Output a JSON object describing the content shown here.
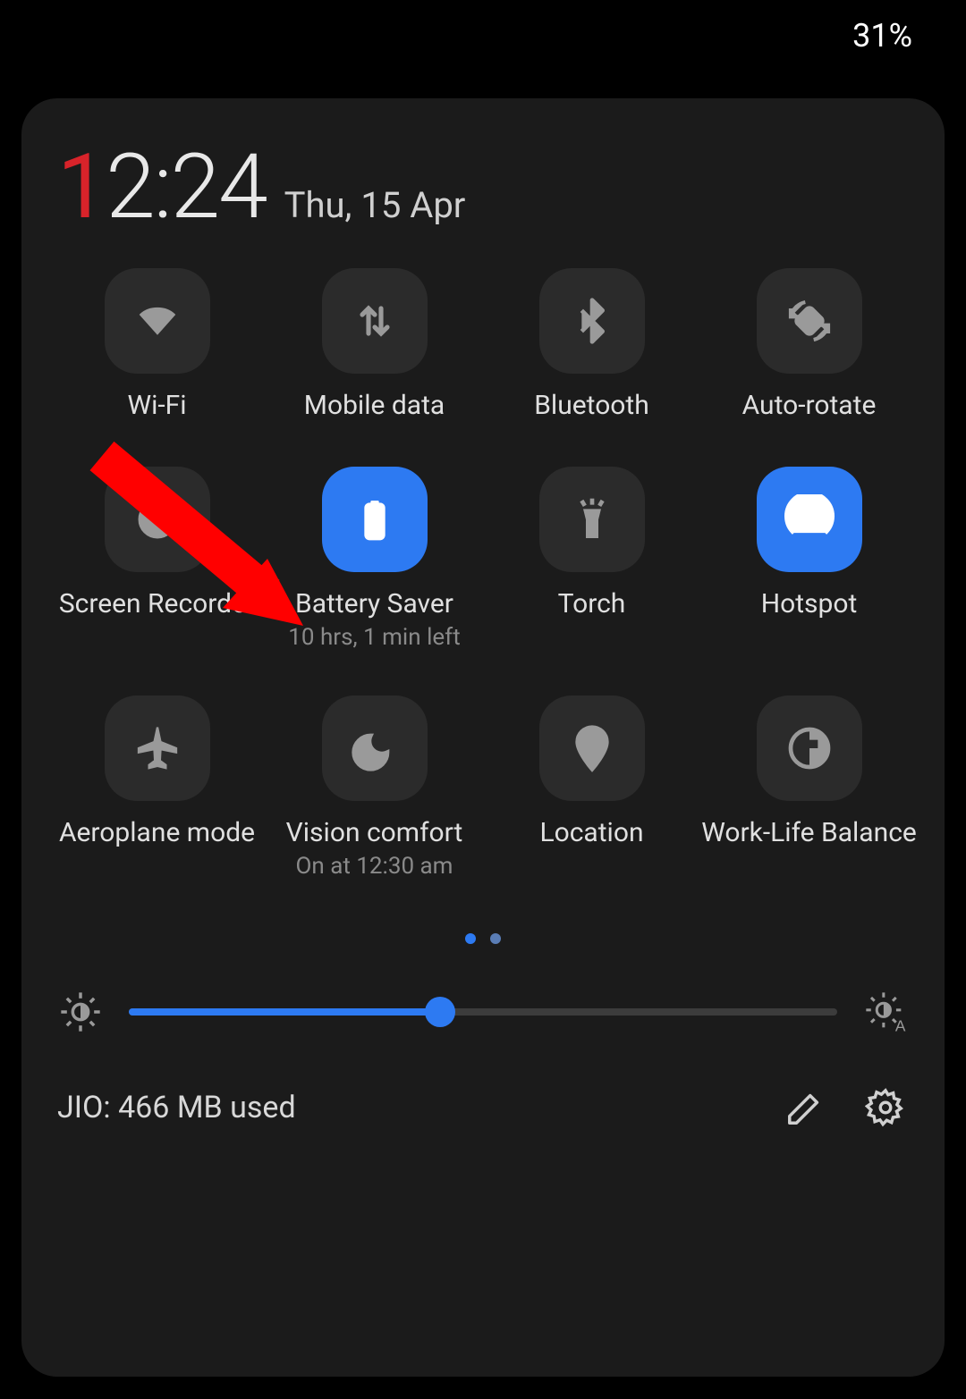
{
  "status": {
    "battery": "31%"
  },
  "clock": {
    "accent": "1",
    "rest": "2:24",
    "date": "Thu, 15 Apr"
  },
  "tiles": [
    {
      "label": "Wi-Fi",
      "sub": "",
      "active": false,
      "icon": "wifi"
    },
    {
      "label": "Mobile data",
      "sub": "",
      "active": false,
      "icon": "mobiledata"
    },
    {
      "label": "Bluetooth",
      "sub": "",
      "active": false,
      "icon": "bluetooth"
    },
    {
      "label": "Auto-rotate",
      "sub": "",
      "active": false,
      "icon": "autorotate"
    },
    {
      "label": "Screen Recorder",
      "sub": "",
      "active": false,
      "icon": "screenrec"
    },
    {
      "label": "Battery Saver",
      "sub": "10 hrs, 1 min left",
      "active": true,
      "icon": "battery"
    },
    {
      "label": "Torch",
      "sub": "",
      "active": false,
      "icon": "torch"
    },
    {
      "label": "Hotspot",
      "sub": "",
      "active": true,
      "icon": "hotspot"
    },
    {
      "label": "Aeroplane mode",
      "sub": "",
      "active": false,
      "icon": "airplane"
    },
    {
      "label": "Vision comfort",
      "sub": "On at 12:30 am",
      "active": false,
      "icon": "moon"
    },
    {
      "label": "Location",
      "sub": "",
      "active": false,
      "icon": "location"
    },
    {
      "label": "Work-Life Balance",
      "sub": "",
      "active": false,
      "icon": "worklife"
    }
  ],
  "brightness": {
    "percent": 44
  },
  "bottom": {
    "usage": "JIO: 466 MB used"
  },
  "page_dots": {
    "count": 2,
    "active": 0
  },
  "colors": {
    "accent_blue": "#2d7af2",
    "accent_red": "#d8232a",
    "arrow": "#ff0000"
  }
}
